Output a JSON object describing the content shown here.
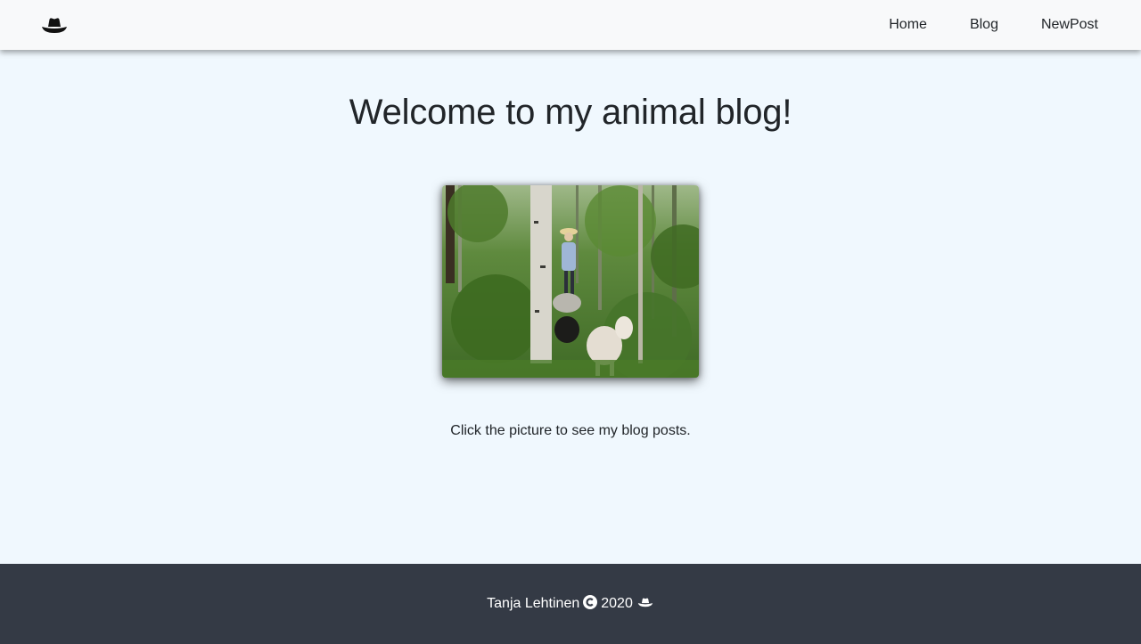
{
  "navbar": {
    "brand_icon": "hat-icon",
    "links": [
      {
        "label": "Home"
      },
      {
        "label": "Blog"
      },
      {
        "label": "NewPost"
      }
    ]
  },
  "main": {
    "heading": "Welcome to my animal blog!",
    "photo_icon": "forest-sheep-photo",
    "caption": "Click the picture to see my blog posts."
  },
  "footer": {
    "author": "Tanja Lehtinen",
    "copyright_icon": "copyright-icon",
    "year": "2020",
    "hat_icon": "hat-icon"
  },
  "colors": {
    "page_background": "#f0f8fe",
    "navbar_background": "#f8f9fa",
    "footer_background": "#343a45",
    "text": "#212529"
  }
}
